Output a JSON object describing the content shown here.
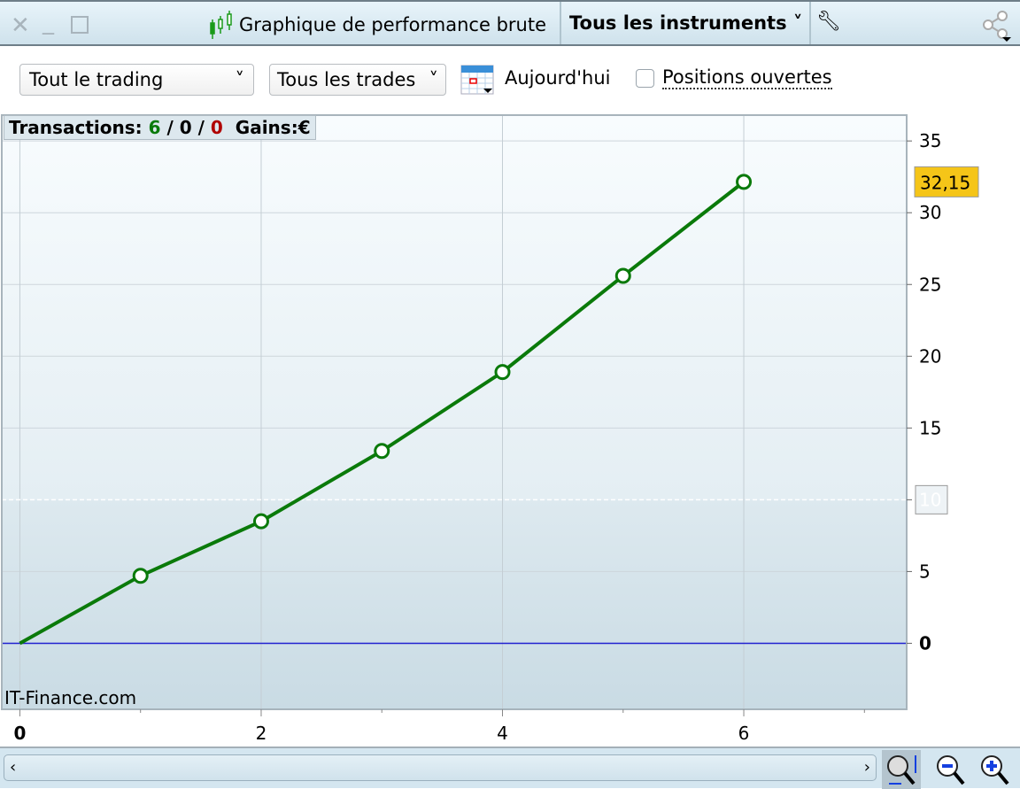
{
  "window": {
    "title": "Graphique de performance brute",
    "instrument_selector": "Tous les instruments",
    "icons": [
      "close-icon",
      "minimize-icon",
      "maximize-icon",
      "candlestick-icon",
      "wrench-icon",
      "share-icon"
    ]
  },
  "toolbar": {
    "scope_select": "Tout le trading",
    "trades_select": "Tous les trades",
    "date_label": "Aujourd'hui",
    "open_positions_label": "Positions ouvertes",
    "open_positions_checked": false
  },
  "info": {
    "transactions_label": "Transactions:",
    "total": "6",
    "sep1": "/",
    "neutral": "0",
    "sep2": "/",
    "losses": "0",
    "gains_label": "Gains:",
    "currency": "€"
  },
  "watermark": "IT-Finance.com",
  "colors": {
    "line": "#0a7a0a",
    "zero_line": "#2020d0",
    "last_value_badge": "#f5c518",
    "wins": "#0a7a0a",
    "losses": "#b00000"
  },
  "chart_data": {
    "type": "line",
    "x": [
      0,
      1,
      2,
      3,
      4,
      5,
      6
    ],
    "values": [
      0,
      4.7,
      8.5,
      13.4,
      18.9,
      25.6,
      32.15
    ],
    "xlim": [
      -0.15,
      7.35
    ],
    "ylim": [
      -4.6,
      36.8
    ],
    "x_ticks": [
      0,
      2,
      4,
      6
    ],
    "x_tick_labels": [
      "0",
      "2",
      "4",
      "6"
    ],
    "y_ticks": [
      0,
      5,
      10,
      15,
      20,
      25,
      30,
      35
    ],
    "y_tick_labels": [
      "0",
      "5",
      "10",
      "15",
      "20",
      "25",
      "30",
      "35"
    ],
    "last_value_label": "32,15",
    "reference_line": 10,
    "grid": true,
    "markers": "hollow-circle"
  }
}
